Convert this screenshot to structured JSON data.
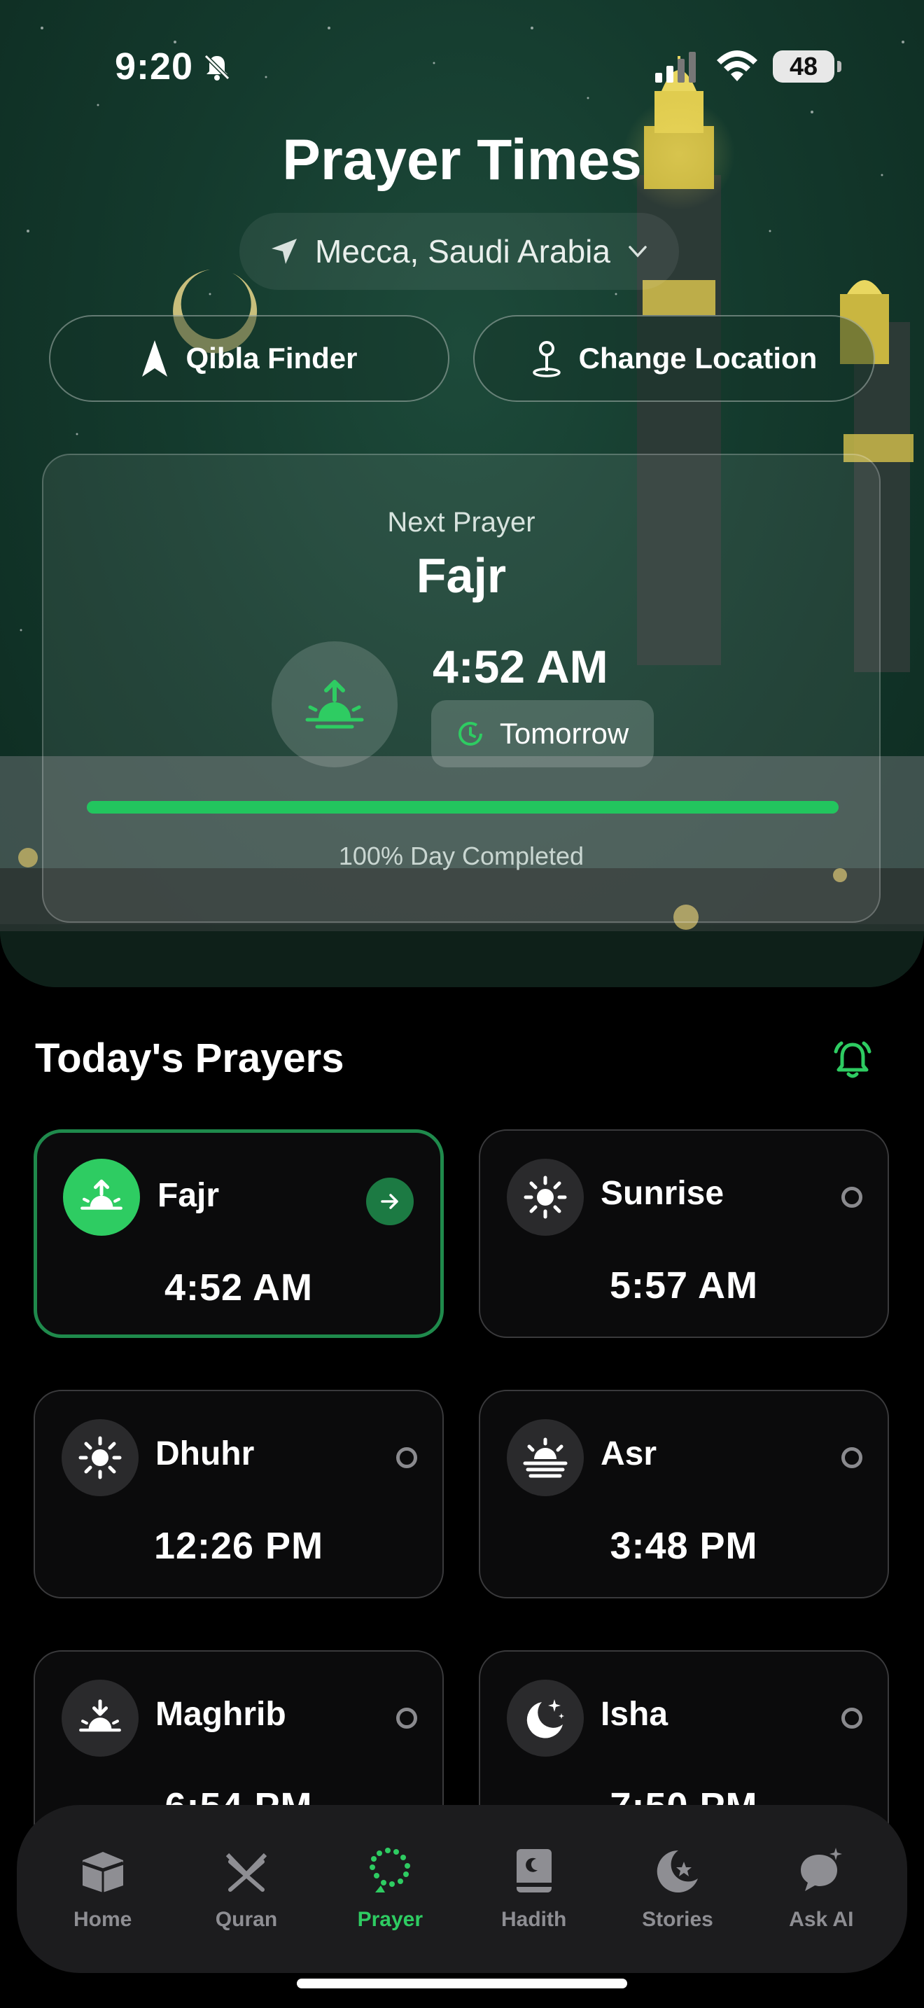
{
  "status_bar": {
    "time": "9:20",
    "battery": "48"
  },
  "header": {
    "title": "Prayer Times",
    "location": "Mecca, Saudi Arabia",
    "qibla_button": "Qibla Finder",
    "change_location_button": "Change Location"
  },
  "next_prayer": {
    "label": "Next Prayer",
    "name": "Fajr",
    "time": "4:52 AM",
    "day_badge": "Tomorrow",
    "progress": 1.0,
    "progress_text": "100% Day Completed"
  },
  "today": {
    "title": "Today's Prayers",
    "prayers": [
      {
        "name": "Fajr",
        "time": "4:52 AM",
        "icon": "sunrise-up-icon",
        "active": true
      },
      {
        "name": "Sunrise",
        "time": "5:57 AM",
        "icon": "sun-icon",
        "active": false
      },
      {
        "name": "Dhuhr",
        "time": "12:26 PM",
        "icon": "sun-icon",
        "active": false
      },
      {
        "name": "Asr",
        "time": "3:48 PM",
        "icon": "sun-haze-icon",
        "active": false
      },
      {
        "name": "Maghrib",
        "time": "6:54 PM",
        "icon": "sunset-down-icon",
        "active": false
      },
      {
        "name": "Isha",
        "time": "7:50 PM",
        "icon": "moon-stars-icon",
        "active": false
      }
    ]
  },
  "tabs": [
    {
      "label": "Home",
      "icon": "kaaba-icon",
      "active": false
    },
    {
      "label": "Quran",
      "icon": "quran-stand-icon",
      "active": false
    },
    {
      "label": "Prayer",
      "icon": "tasbih-icon",
      "active": true
    },
    {
      "label": "Hadith",
      "icon": "book-icon",
      "active": false
    },
    {
      "label": "Stories",
      "icon": "crescent-star-icon",
      "active": false
    },
    {
      "label": "Ask AI",
      "icon": "chat-sparkle-icon",
      "active": false
    }
  ],
  "colors": {
    "accent": "#2ecc62",
    "hero": "#143a2d",
    "card_border": "#3a3a3c"
  }
}
